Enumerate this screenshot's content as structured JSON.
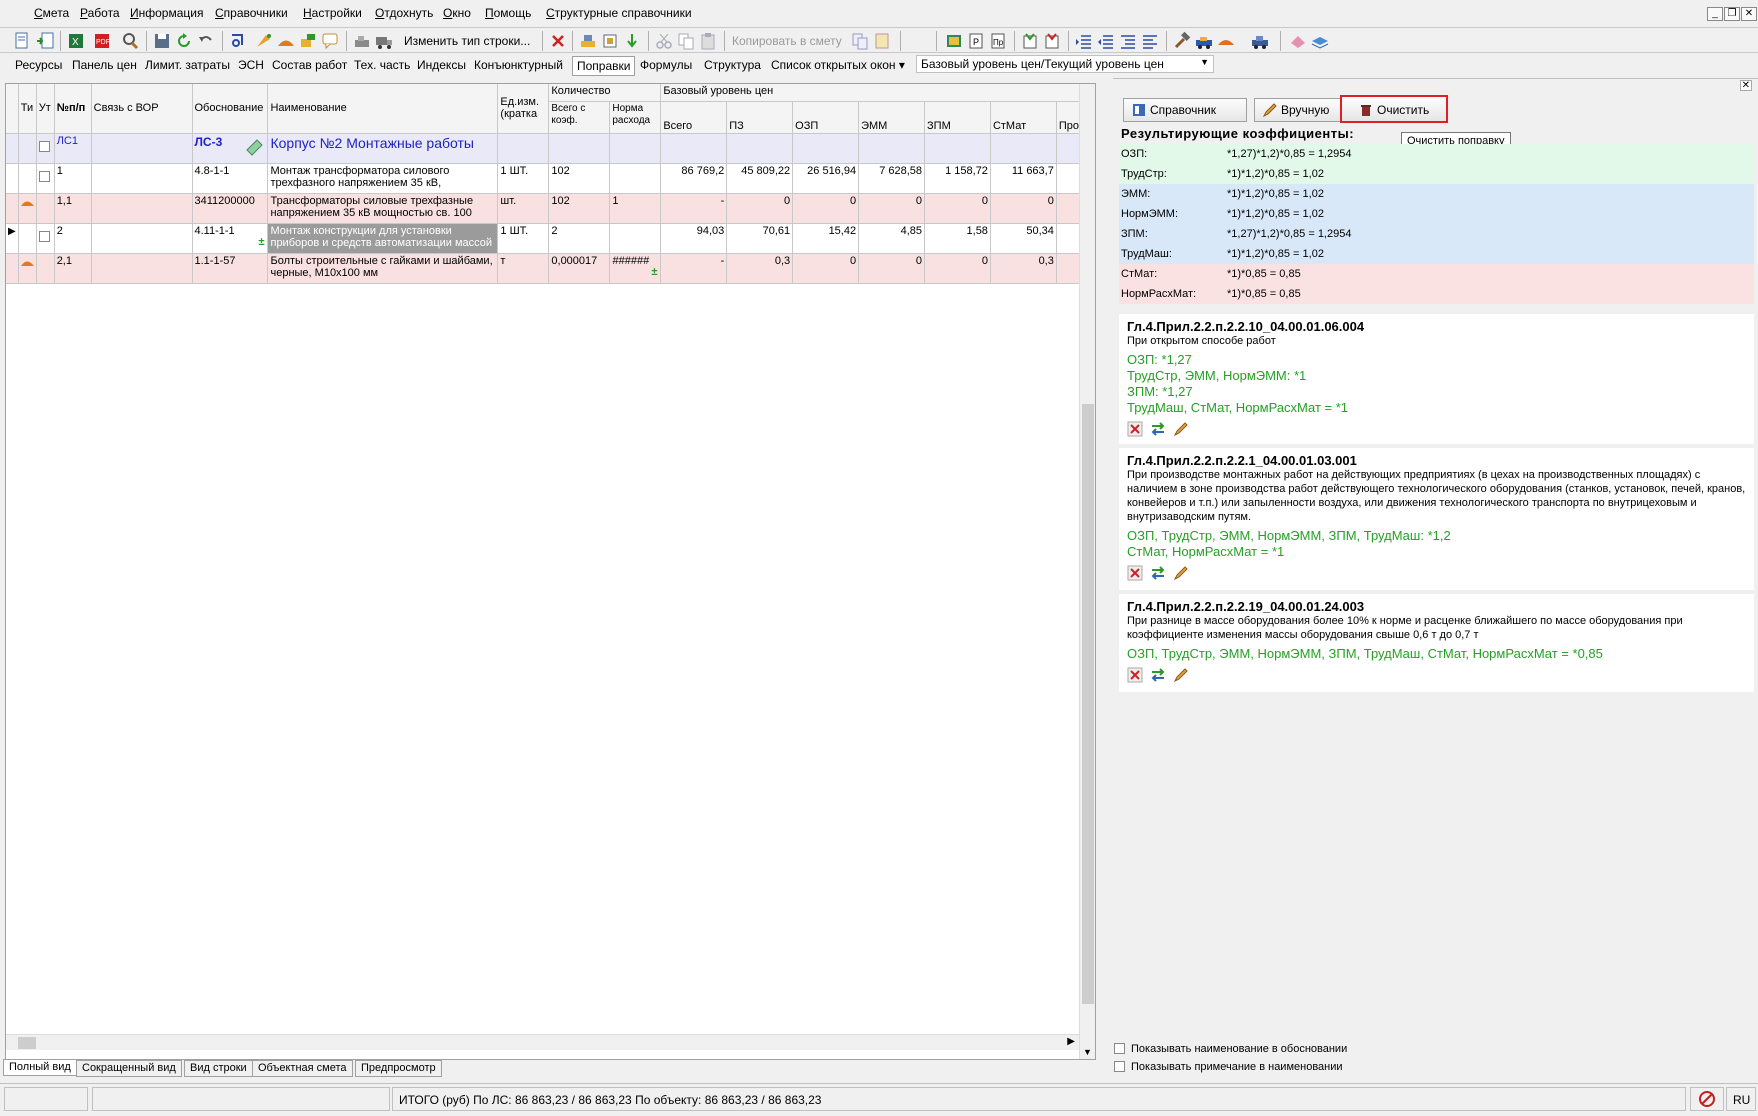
{
  "menu": [
    "Смета",
    "Работа",
    "Информация",
    "Справочники",
    "Настройки",
    "Отдохнуть",
    "Окно",
    "Помощь",
    "Структурные справочники"
  ],
  "toolbar": {
    "change_type": "Изменить тип строки...",
    "copy_to_estimate": "Копировать в смету"
  },
  "tabs": [
    "Ресурсы",
    "Панель цен",
    "Лимит. затраты",
    "ЭСН",
    "Состав работ",
    "Тех. часть",
    "Индексы",
    "Конъюнктурный",
    "Поправки",
    "Формулы",
    "Структура",
    "Список открытых окон ▾"
  ],
  "active_tab": "Поправки",
  "level_select": "Базовый уровень цен/Текущий уровень цен",
  "grid": {
    "headers": {
      "ti": "Ти",
      "ut": "Ут",
      "num": "№п/п",
      "vor": "Связь с ВОР",
      "basis": "Обоснование",
      "name": "Наименование",
      "unit": "Ед.изм. (кратка",
      "qty": "Количество",
      "qty_total": "Всего с коэф.",
      "qty_norm": "Норма расхода",
      "price_group": "Базовый уровень цен"
    },
    "price_cols": [
      "Всего",
      "ПЗ",
      "ОЗП",
      "ЭММ",
      "ЗПМ",
      "СтМат",
      "Прочи"
    ],
    "rows": [
      {
        "type": "ls",
        "num": "ЛС1",
        "basis": "ЛС-3",
        "name": "Корпус №2 Монтажные работы",
        "unit": "",
        "qty_total": "",
        "qty_norm": "",
        "vals": [
          "",
          "",
          "",
          "",
          "",
          "",
          ""
        ]
      },
      {
        "type": "w",
        "num": "1",
        "basis": "4.8-1-1",
        "name": "Монтаж трансформатора силового трехфазного напряжением 35 кВ,",
        "unit": "1 ШТ.",
        "qty_total": "102",
        "qty_norm": "",
        "vals": [
          "86 769,2",
          "45 809,22",
          "26 516,94",
          "7 628,58",
          "1 158,72",
          "11 663,7",
          ""
        ]
      },
      {
        "type": "p",
        "num": "1,1",
        "basis": "3411200000",
        "name": "Трансформаторы силовые трехфазные напряжением 35 кВ мощностью св. 100",
        "unit": "шт.",
        "qty_total": "102",
        "qty_norm": "1",
        "vals": [
          "-",
          "0",
          "0",
          "0",
          "0",
          "0",
          ""
        ]
      },
      {
        "type": "sel",
        "num": "2",
        "basis": "4.11-1-1",
        "name": "Монтаж конструкции для установки приборов и средств автоматизации массой",
        "unit": "1 ШТ.",
        "qty_total": "2",
        "qty_norm": "",
        "vals": [
          "94,03",
          "70,61",
          "15,42",
          "4,85",
          "1,58",
          "50,34",
          ""
        ]
      },
      {
        "type": "p",
        "num": "2,1",
        "basis": "1.1-1-57",
        "name": "Болты строительные с гайками и шайбами, черные, М10х100 мм",
        "unit": "т",
        "qty_total": "0,000017",
        "qty_norm": "######",
        "vals": [
          "-",
          "0,3",
          "0",
          "0",
          "0",
          "0,3",
          ""
        ]
      }
    ]
  },
  "bottom_tabs": [
    "Полный вид",
    "Сокращенный вид",
    "Вид строки",
    "Объектная смета",
    "Предпросмотр"
  ],
  "status": {
    "total": "ИТОГО (руб)  По ЛС: 86 863,23 / 86 863,23     По объекту: 86 863,23 / 86 863,23",
    "lang": "RU"
  },
  "panel": {
    "btn_ref": "Справочник",
    "btn_manual": "Вручную",
    "btn_clear": "Очистить",
    "tooltip": "Очистить поправку",
    "coef_header": "Результирующие коэффициенты:",
    "coefs": [
      {
        "n": "ОЗП:",
        "v": "*1,27)*1,2)*0,85 = 1,2954",
        "c": "#e2f8e8"
      },
      {
        "n": "ТрудСтр:",
        "v": "*1)*1,2)*0,85 = 1,02",
        "c": "#e2f8e8"
      },
      {
        "n": "ЭММ:",
        "v": "*1)*1,2)*0,85 = 1,02",
        "c": "#d8e8f8"
      },
      {
        "n": "НормЭММ:",
        "v": "*1)*1,2)*0,85 = 1,02",
        "c": "#d8e8f8"
      },
      {
        "n": "ЗПМ:",
        "v": "*1,27)*1,2)*0,85 = 1,2954",
        "c": "#d8e8f8"
      },
      {
        "n": "ТрудМаш:",
        "v": "*1)*1,2)*0,85 = 1,02",
        "c": "#d8e8f8"
      },
      {
        "n": "СтМат:",
        "v": "*1)*0,85 = 0,85",
        "c": "#fbe2e2"
      },
      {
        "n": "НормРасхМат:",
        "v": "*1)*0,85 = 0,85",
        "c": "#fbe2e2"
      }
    ],
    "cards": [
      {
        "title": "Гл.4.Прил.2.2.п.2.2.10_04.00.01.06.004",
        "desc": "При открытом способе работ",
        "green": [
          "ОЗП: *1,27",
          "ТрудСтр, ЭММ, НормЭММ: *1",
          "ЗПМ: *1,27",
          "ТрудМаш, СтМат, НормРасхМат = *1"
        ]
      },
      {
        "title": "Гл.4.Прил.2.2.п.2.2.1_04.00.01.03.001",
        "desc": "При производстве монтажных работ на действующих предприятиях (в цехах на производственных площадях) с наличием в зоне производства работ действующего технологического оборудования (станков, установок, печей, кранов, конвейеров и т.п.) или запыленности воздуха, или движения технологического транспорта по внутрицеховым и внутризаводским путям.",
        "green": [
          "ОЗП, ТрудСтр, ЭММ, НормЭММ, ЗПМ, ТрудМаш: *1,2",
          "СтМат, НормРасхМат = *1"
        ]
      },
      {
        "title": "Гл.4.Прил.2.2.п.2.2.19_04.00.01.24.003",
        "desc": "При разнице в массе оборудования более 10% к норме и расценке ближайшего по массе оборудования при коэффициенте изменения массы оборудования свыше 0,6 т до 0,7 т",
        "green": [
          "ОЗП, ТрудСтр, ЭММ, НормЭММ, ЗПМ, ТрудМаш, СтМат, НормРасхМат = *0,85"
        ]
      }
    ],
    "chk1": "Показывать наименование в обосновании",
    "chk2": "Показывать примечание в наименовании"
  }
}
